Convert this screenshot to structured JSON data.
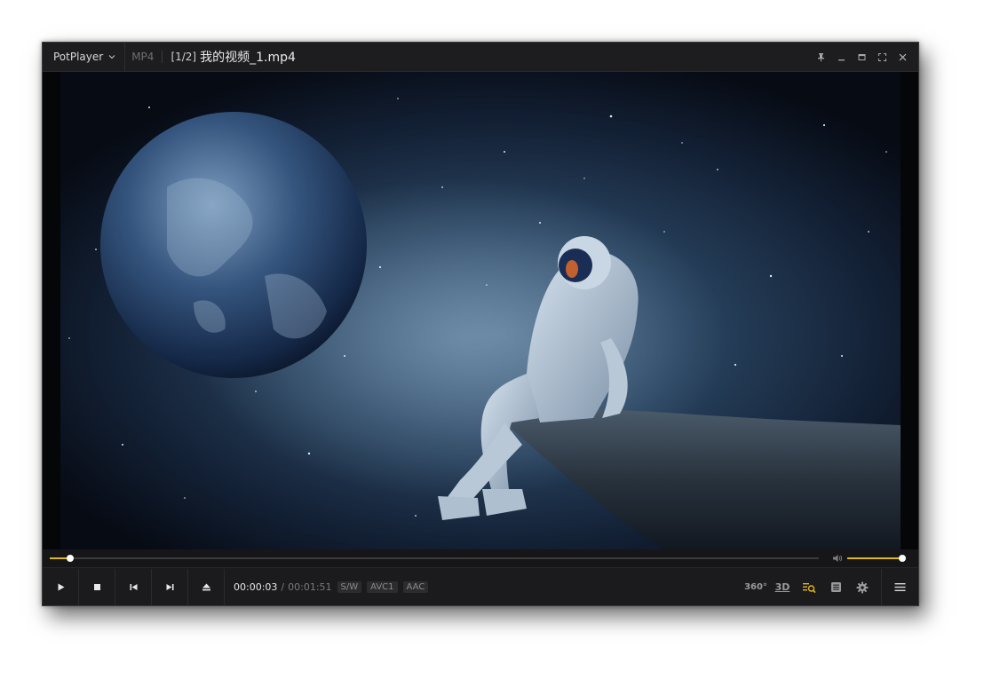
{
  "titlebar": {
    "app_name": "PotPlayer",
    "format": "MP4",
    "playlist_position": "[1/2]",
    "file_title": "我的视频_1.mp4"
  },
  "playback": {
    "current_time": "00:00:03",
    "separator": "/",
    "total_time": "00:01:51",
    "progress_fraction": 0.027,
    "volume_fraction": 1.0
  },
  "tags": {
    "renderer": "S/W",
    "video_codec": "AVC1",
    "audio_codec": "AAC"
  },
  "buttons": {
    "vr_label": "360°",
    "three_d_label": "3D"
  },
  "icons": {
    "app_menu": "chevron-down-icon",
    "pin": "pin-icon",
    "minimize": "minimize-icon",
    "maximize": "maximize-icon",
    "fullscreen": "fullscreen-icon",
    "close": "close-icon",
    "play": "play-icon",
    "stop": "stop-icon",
    "previous": "skip-previous-icon",
    "next": "skip-next-icon",
    "eject": "eject-icon",
    "playlist": "playlist-search-icon",
    "chapters": "chapter-list-icon",
    "settings": "gear-icon",
    "menu": "hamburger-menu-icon",
    "volume": "speaker-icon"
  },
  "colors": {
    "accent": "#e0b818",
    "background": "#1b1b1d",
    "text": "#e6e6e6",
    "muted_text": "#7a7a7c"
  }
}
